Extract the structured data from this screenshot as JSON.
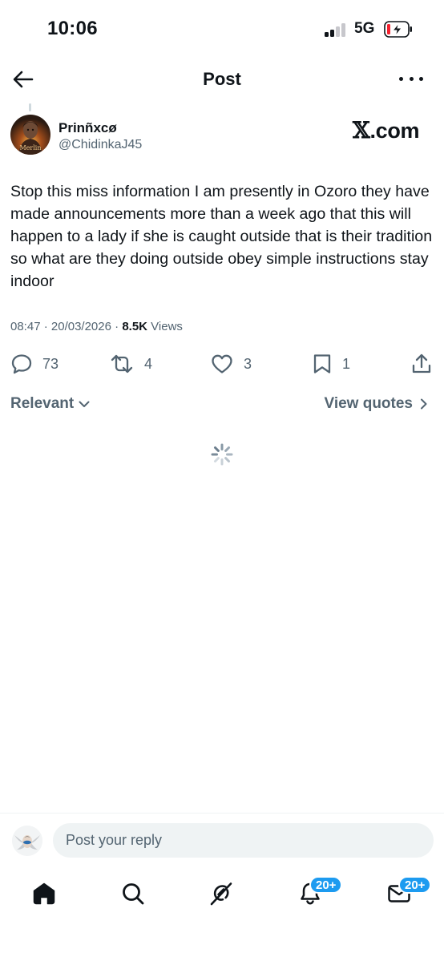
{
  "status_bar": {
    "time": "10:06",
    "network": "5G"
  },
  "header": {
    "title": "Post"
  },
  "post": {
    "author_name": "Prinñxcø",
    "author_handle": "@ChidinkaJ45",
    "avatar_caption": "Merlin",
    "watermark_symbol": "𝕏",
    "watermark_suffix": ".com",
    "text": "Stop this miss information I am presently in Ozoro they have made announcements more than a week ago that this will happen to a lady if she is caught outside that is their tradition so what are they doing outside obey simple instructions stay indoor",
    "time": "08:47",
    "date": "20/03/2026",
    "views_count": "8.5K",
    "views_label": "Views",
    "replies": "73",
    "reposts": "4",
    "likes": "3",
    "bookmarks": "1"
  },
  "replies_section": {
    "sort_label": "Relevant",
    "quotes_label": "View quotes"
  },
  "reply_bar": {
    "placeholder": "Post your reply"
  },
  "tab_bar": {
    "notifications_badge": "20+",
    "messages_badge": "20+"
  },
  "colors": {
    "text_primary": "#0f1419",
    "text_secondary": "#536471",
    "accent": "#1d9bf0",
    "battery_low": "#f4212e"
  },
  "icons": {
    "back": "arrow-left-icon",
    "more": "more-horizontal-icon",
    "reply": "speech-bubble-icon",
    "repost": "repost-arrows-icon",
    "like": "heart-icon",
    "bookmark": "bookmark-icon",
    "share": "share-upload-icon",
    "home": "home-icon",
    "search": "search-icon",
    "grok": "grok-icon",
    "notifications": "bell-icon",
    "messages": "envelope-icon"
  }
}
